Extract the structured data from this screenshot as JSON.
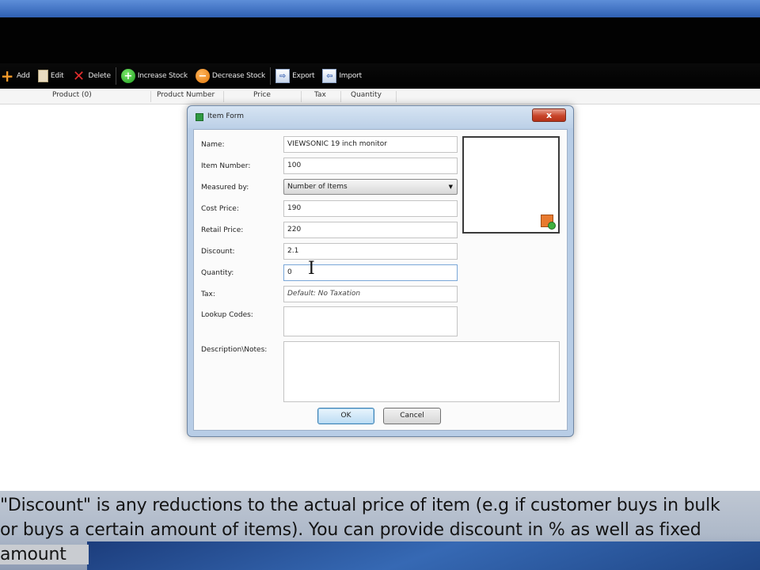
{
  "toolbar": {
    "buttons": [
      {
        "label": "Add",
        "icon": "plus-icon"
      },
      {
        "label": "Edit",
        "icon": "edit-icon"
      },
      {
        "label": "Delete",
        "icon": "delete-x-icon"
      },
      {
        "label": "Increase Stock",
        "icon": "increase-stock-icon"
      },
      {
        "label": "Decrease Stock",
        "icon": "decrease-stock-icon"
      },
      {
        "label": "Export",
        "icon": "export-icon"
      },
      {
        "label": "Import",
        "icon": "import-icon"
      }
    ]
  },
  "table": {
    "columns": [
      "Product (0)",
      "Product Number",
      "Price",
      "Tax",
      "Quantity"
    ]
  },
  "dialog": {
    "title": "Item Form",
    "fields": {
      "name": {
        "label": "Name:",
        "value": "VIEWSONIC 19 inch monitor"
      },
      "item_number": {
        "label": "Item Number:",
        "value": "100"
      },
      "measured_by": {
        "label": "Measured by:",
        "value": "Number of Items"
      },
      "cost_price": {
        "label": "Cost Price:",
        "value": "190"
      },
      "retail_price": {
        "label": "Retail Price:",
        "value": "220"
      },
      "discount": {
        "label": "Discount:",
        "value": "2.1"
      },
      "quantity": {
        "label": "Quantity:",
        "value": "0"
      },
      "tax": {
        "label": "Tax:",
        "value": "Default: No Taxation"
      },
      "lookup_codes": {
        "label": "Lookup Codes:",
        "value": ""
      },
      "description": {
        "label": "Description\\Notes:",
        "value": ""
      }
    },
    "ok_label": "OK",
    "cancel_label": "Cancel",
    "close_glyph": "x"
  },
  "caption": {
    "line1": "\"Discount\" is any reductions to the actual price of item (e.g if customer buys in bulk",
    "line2": "or buys a certain amount of items). You can provide discount in % as well as fixed",
    "line3": "amount"
  },
  "colors": {
    "toolbar_bg": "#000000",
    "dialog_frame": "#b8cde6",
    "ok_button": "#bcdcf3",
    "close_button": "#c8452a"
  }
}
